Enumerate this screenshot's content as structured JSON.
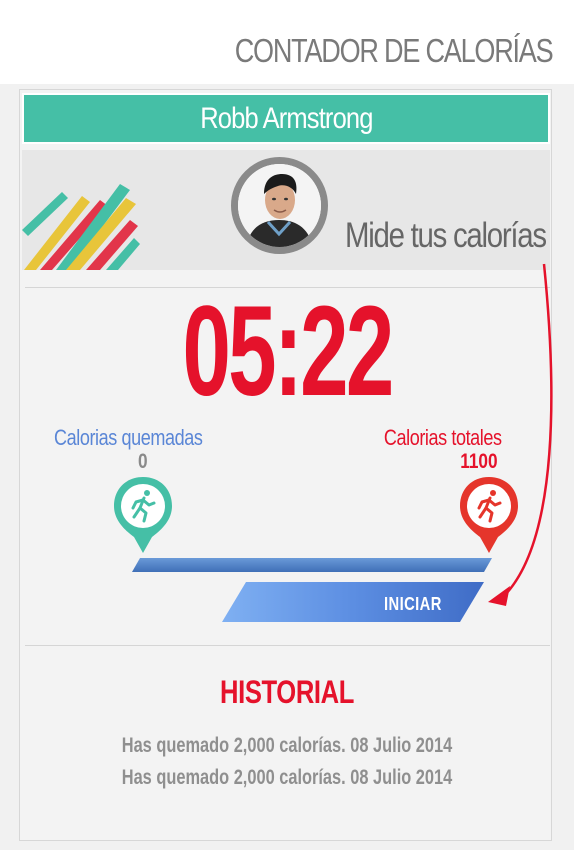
{
  "header": {
    "title": "CONTADOR DE CALORÍAS"
  },
  "profile": {
    "name": "Robb Armstrong",
    "tagline": "Mide tus calorías"
  },
  "timer": {
    "value": "05:22"
  },
  "burned": {
    "label": "Calorias quemadas",
    "value": "0"
  },
  "total": {
    "label": "Calorias totales",
    "value": "1100"
  },
  "progress": {
    "fraction": 0
  },
  "actions": {
    "start_label": "INICIAR"
  },
  "history": {
    "title": "HISTORIAL",
    "items": [
      "Has quemado 2,000 calorías. 08 Julio 2014",
      "Has quemado 2,000 calorías. 08 Julio 2014"
    ]
  },
  "colors": {
    "accent_teal": "#45bfa6",
    "accent_red": "#e5122b",
    "accent_blue": "#5a86d6",
    "muted_gray": "#8a8a8a"
  },
  "icons": {
    "burned": "running-person-icon",
    "total": "running-person-icon",
    "avatar": "user-avatar"
  }
}
